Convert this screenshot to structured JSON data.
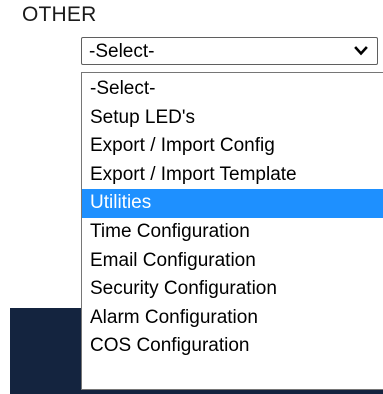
{
  "section": {
    "label": "OTHER"
  },
  "select": {
    "value": "-Select-",
    "icon": "chevron-down-icon"
  },
  "dropdown": {
    "highlight_color": "#1e90ff",
    "options": [
      {
        "label": "-Select-",
        "highlighted": false
      },
      {
        "label": "Setup LED's",
        "highlighted": false
      },
      {
        "label": "Export / Import Config",
        "highlighted": false
      },
      {
        "label": "Export / Import Template",
        "highlighted": false
      },
      {
        "label": "Utilities",
        "highlighted": true
      },
      {
        "label": "Time Configuration",
        "highlighted": false
      },
      {
        "label": "Email Configuration",
        "highlighted": false
      },
      {
        "label": "Security Configuration",
        "highlighted": false
      },
      {
        "label": "Alarm Configuration",
        "highlighted": false
      },
      {
        "label": "COS Configuration",
        "highlighted": false
      }
    ]
  },
  "colors": {
    "panel_background": "#14243f"
  }
}
